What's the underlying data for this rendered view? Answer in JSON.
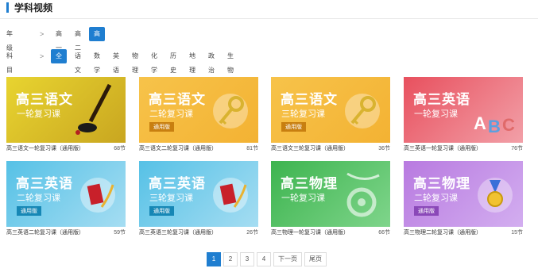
{
  "section": {
    "title": "学科视频"
  },
  "grade": {
    "label": "年级",
    "options": [
      "高一",
      "高二",
      "高三"
    ],
    "selected": "高三"
  },
  "subject": {
    "label": "科目",
    "options": [
      "全部",
      "语文",
      "数学",
      "英语",
      "物理",
      "化学",
      "历史",
      "地理",
      "政治",
      "生物"
    ],
    "selected": "全部"
  },
  "courses": [
    {
      "thumb_title": "高三语文",
      "thumb_sub": "一轮复习课",
      "thumb_badge": "",
      "caption": "高三语文一轮复习课（通用版）",
      "count": "68节"
    },
    {
      "thumb_title": "高三语文",
      "thumb_sub": "二轮复习课",
      "thumb_badge": "通用版",
      "caption": "高三语文二轮复习课（通用版）",
      "count": "81节"
    },
    {
      "thumb_title": "高三语文",
      "thumb_sub": "三轮复习课",
      "thumb_badge": "通用版",
      "caption": "高三语文三轮复习课（通用版）",
      "count": "36节"
    },
    {
      "thumb_title": "高三英语",
      "thumb_sub": "一轮复习课",
      "thumb_badge": "",
      "caption": "高三英语一轮复习课（通用版）",
      "count": "76节"
    },
    {
      "thumb_title": "高三英语",
      "thumb_sub": "二轮复习课",
      "thumb_badge": "通用版",
      "caption": "高三英语二轮复习课（通用版）",
      "count": "59节"
    },
    {
      "thumb_title": "高三英语",
      "thumb_sub": "三轮复习课",
      "thumb_badge": "通用版",
      "caption": "高三英语三轮复习课（通用版）",
      "count": "26节"
    },
    {
      "thumb_title": "高三物理",
      "thumb_sub": "一轮复习课",
      "thumb_badge": "",
      "caption": "高三物理一轮复习课（通用版）",
      "count": "66节"
    },
    {
      "thumb_title": "高三物理",
      "thumb_sub": "二轮复习课",
      "thumb_badge": "通用版",
      "caption": "高三物理二轮复习课（通用版）",
      "count": "15节"
    }
  ],
  "pagination": {
    "pages": [
      "1",
      "2",
      "3",
      "4"
    ],
    "current": "1",
    "next_label": "下一页",
    "last_label": "尾页"
  },
  "colors": {
    "accent": "#1f7ed0",
    "yuwen_1": "#e8d430",
    "yuwen_orange": "#f3b233",
    "yingyu_red": "#e8505e",
    "yingyu_blue": "#56c1e6",
    "wuli_green": "#3db44f",
    "wuli_purple": "#b87ae0"
  }
}
